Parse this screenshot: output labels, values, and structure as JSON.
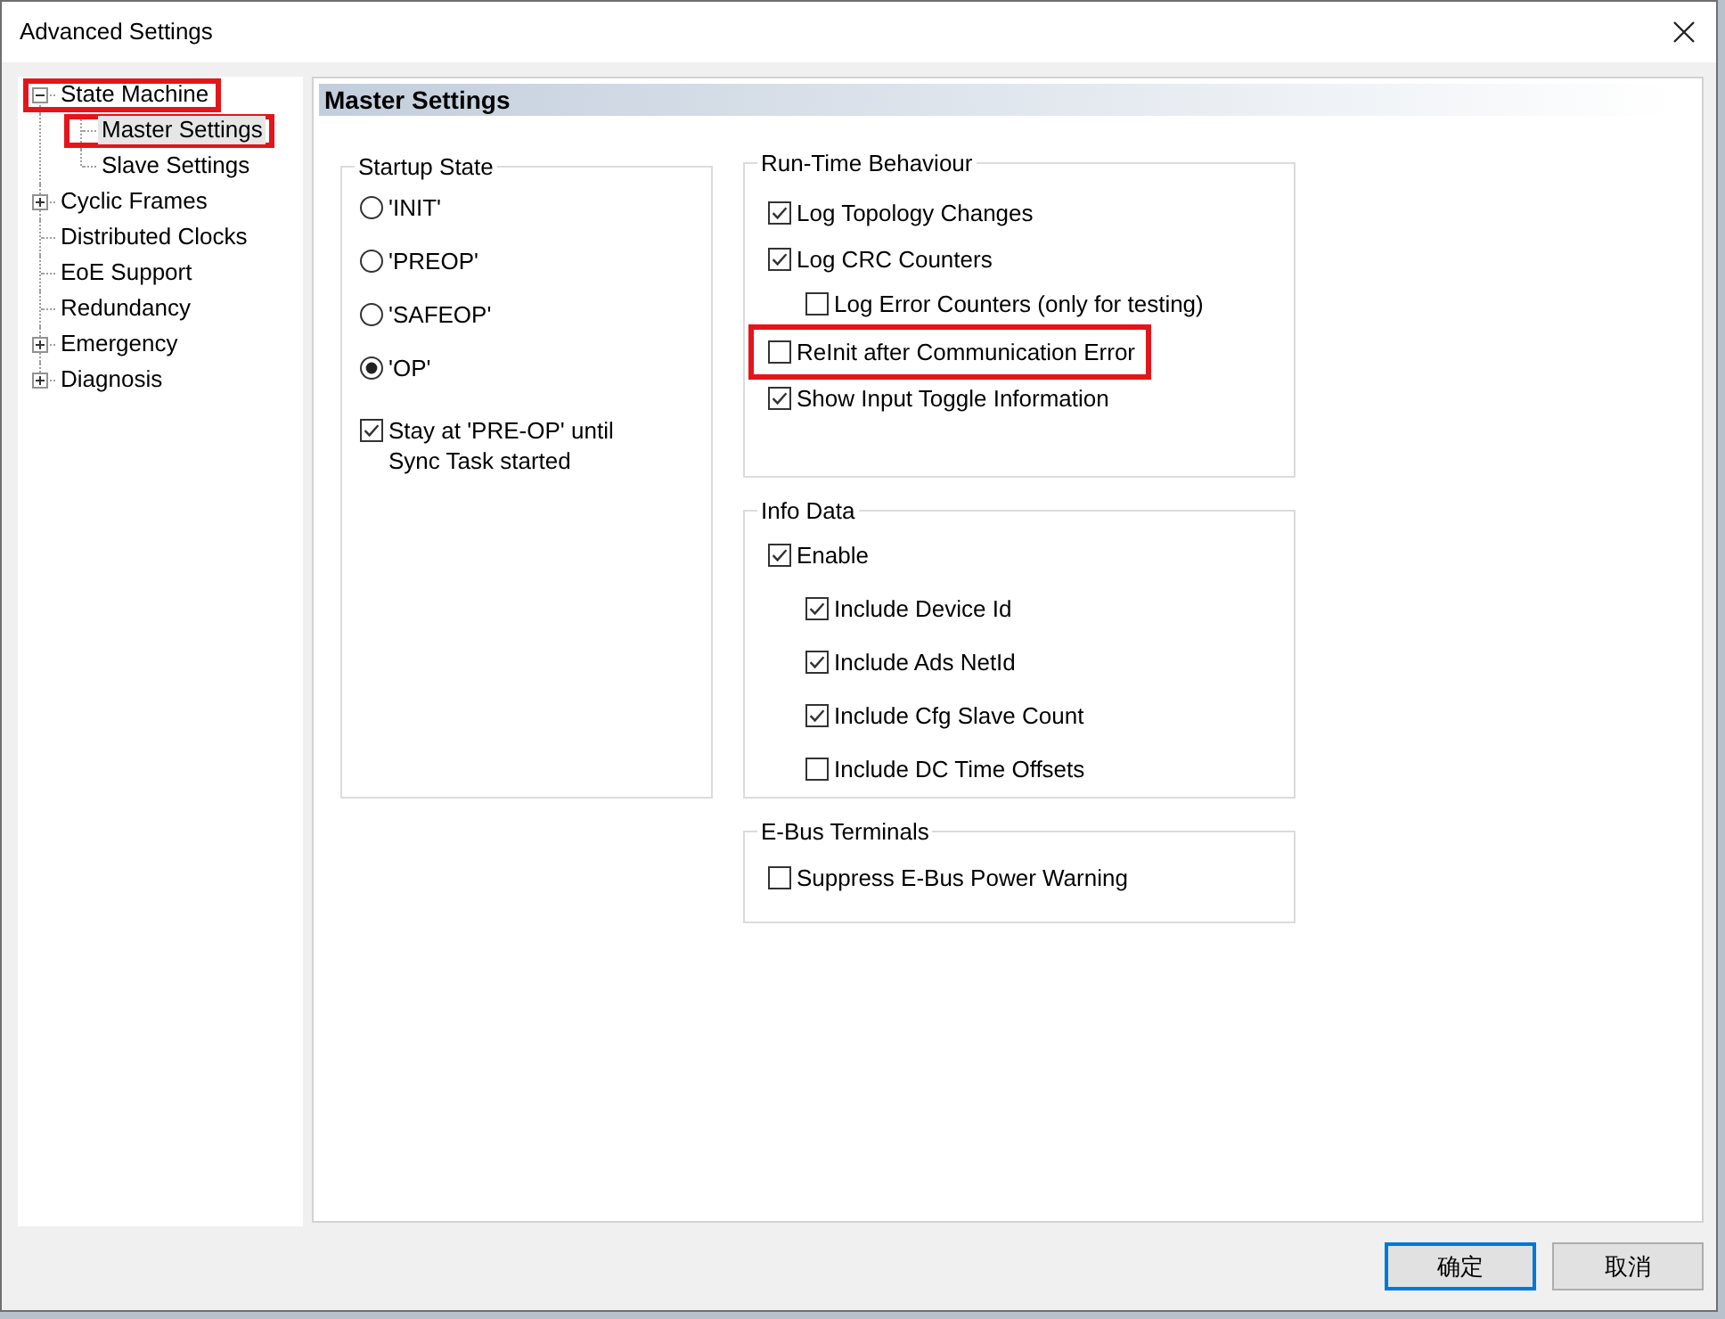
{
  "window": {
    "title": "Advanced Settings"
  },
  "tree": [
    {
      "label": "State Machine",
      "expanded": true,
      "selected": false,
      "highlighted": true,
      "children": [
        {
          "label": "Master Settings",
          "selected": true,
          "highlighted": true
        },
        {
          "label": "Slave Settings",
          "selected": false,
          "highlighted": false
        }
      ]
    },
    {
      "label": "Cyclic Frames",
      "expanded": false,
      "selected": false,
      "highlighted": false
    },
    {
      "label": "Distributed Clocks",
      "selected": false,
      "highlighted": false
    },
    {
      "label": "EoE Support",
      "selected": false,
      "highlighted": false
    },
    {
      "label": "Redundancy",
      "selected": false,
      "highlighted": false
    },
    {
      "label": "Emergency",
      "expanded": false,
      "selected": false,
      "highlighted": false
    },
    {
      "label": "Diagnosis",
      "expanded": false,
      "selected": false,
      "highlighted": false
    }
  ],
  "panel": {
    "title": "Master Settings",
    "groups": [
      {
        "title": "Startup State",
        "options": [
          {
            "kind": "radio",
            "label": "'INIT'",
            "selected": false,
            "highlighted": false
          },
          {
            "kind": "radio",
            "label": "'PREOP'",
            "selected": false,
            "highlighted": false
          },
          {
            "kind": "radio",
            "label": "'SAFEOP'",
            "selected": false,
            "highlighted": false
          },
          {
            "kind": "radio",
            "label": "'OP'",
            "selected": true,
            "highlighted": false
          },
          {
            "kind": "checkbox",
            "label": "Stay at 'PRE-OP' until Sync Task started",
            "checked": true,
            "highlighted": false
          }
        ]
      },
      {
        "title": "Run-Time Behaviour",
        "options": [
          {
            "kind": "checkbox",
            "label": "Log Topology Changes",
            "checked": true,
            "highlighted": false
          },
          {
            "kind": "checkbox",
            "label": "Log CRC Counters",
            "checked": true,
            "highlighted": false,
            "children": [
              {
                "kind": "checkbox",
                "label": "Log Error Counters (only for testing)",
                "checked": false,
                "highlighted": false
              }
            ]
          },
          {
            "kind": "checkbox",
            "label": "ReInit after Communication Error",
            "checked": false,
            "highlighted": true
          },
          {
            "kind": "checkbox",
            "label": "Show Input Toggle Information",
            "checked": true,
            "highlighted": false
          }
        ]
      },
      {
        "title": "Info Data",
        "options": [
          {
            "kind": "checkbox",
            "label": "Enable",
            "checked": true,
            "highlighted": false,
            "children": [
              {
                "kind": "checkbox",
                "label": "Include Device Id",
                "checked": true,
                "highlighted": false
              },
              {
                "kind": "checkbox",
                "label": "Include Ads NetId",
                "checked": true,
                "highlighted": false
              },
              {
                "kind": "checkbox",
                "label": "Include Cfg Slave Count",
                "checked": true,
                "highlighted": false
              },
              {
                "kind": "checkbox",
                "label": "Include DC Time Offsets",
                "checked": false,
                "highlighted": false
              }
            ]
          }
        ]
      },
      {
        "title": "E-Bus Terminals",
        "options": [
          {
            "kind": "checkbox",
            "label": "Suppress E-Bus Power Warning",
            "checked": false,
            "highlighted": false
          }
        ]
      }
    ]
  },
  "buttons": [
    {
      "label": "确定",
      "focused": true
    },
    {
      "label": "取消",
      "focused": false
    }
  ]
}
